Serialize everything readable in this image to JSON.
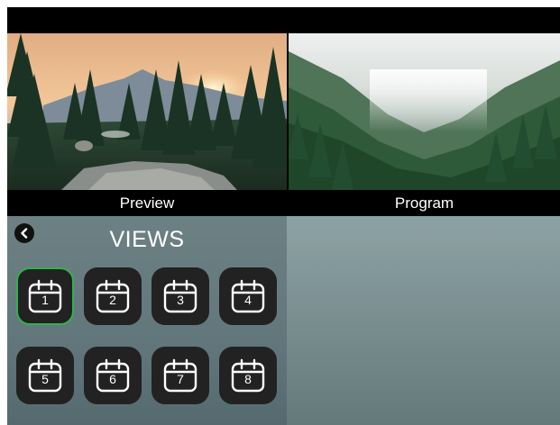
{
  "monitors": {
    "preview": {
      "caption": "Preview"
    },
    "program": {
      "caption": "Program"
    }
  },
  "views_panel": {
    "title": "VIEWS",
    "back_icon": "chevron-left-icon",
    "active_index": 0,
    "buttons": [
      {
        "number": "1",
        "icon": "view-calendar-icon"
      },
      {
        "number": "2",
        "icon": "view-calendar-icon"
      },
      {
        "number": "3",
        "icon": "view-calendar-icon"
      },
      {
        "number": "4",
        "icon": "view-calendar-icon"
      },
      {
        "number": "5",
        "icon": "view-calendar-icon"
      },
      {
        "number": "6",
        "icon": "view-calendar-icon"
      },
      {
        "number": "7",
        "icon": "view-calendar-icon"
      },
      {
        "number": "8",
        "icon": "view-calendar-icon"
      }
    ]
  },
  "colors": {
    "active_border": "#2fb34a",
    "button_bg": "#222222",
    "caption_bar": "#000000"
  }
}
